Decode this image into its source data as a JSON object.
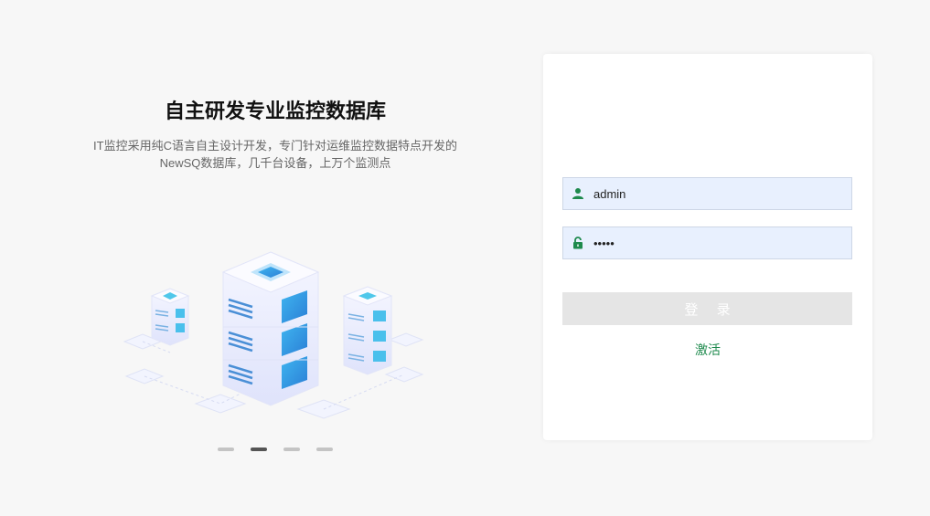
{
  "hero": {
    "title": "自主研发专业监控数据库",
    "description_line1": "IT监控采用纯C语言自主设计开发，专门针对运维监控数据特点开发的",
    "description_line2": "NewSQ数据库，几千台设备，上万个监测点"
  },
  "carousel": {
    "slide_count": 4,
    "active_index": 1
  },
  "login": {
    "username_value": "admin",
    "password_value": "•••••",
    "submit_label": "登 录",
    "activate_label": "激活"
  },
  "colors": {
    "accent_green": "#1e8a4d",
    "input_bg": "#e8f0fe",
    "button_disabled": "#e5e5e5"
  },
  "icons": {
    "username": "user-icon",
    "password": "lock-icon"
  }
}
